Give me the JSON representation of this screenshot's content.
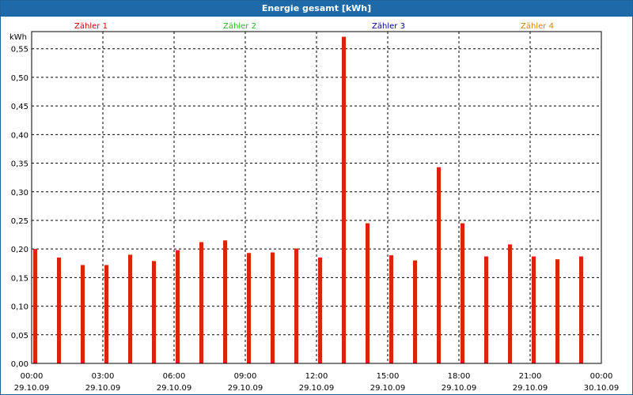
{
  "window": {
    "title": "Energie gesamt [kWh]"
  },
  "chart_data": {
    "type": "bar",
    "title": "Energie gesamt [kWh]",
    "ylabel": "kWh",
    "ylim": [
      0,
      0.58
    ],
    "yticks": [
      "0,00",
      "0,05",
      "0,10",
      "0,15",
      "0,20",
      "0,25",
      "0,30",
      "0,35",
      "0,40",
      "0,45",
      "0,50",
      "0,55"
    ],
    "xticks": [
      {
        "time": "00:00",
        "date": "29.10.09"
      },
      {
        "time": "03:00",
        "date": "29.10.09"
      },
      {
        "time": "06:00",
        "date": "29.10.09"
      },
      {
        "time": "09:00",
        "date": "29.10.09"
      },
      {
        "time": "12:00",
        "date": "29.10.09"
      },
      {
        "time": "15:00",
        "date": "29.10.09"
      },
      {
        "time": "18:00",
        "date": "29.10.09"
      },
      {
        "time": "21:00",
        "date": "29.10.09"
      },
      {
        "time": "00:00",
        "date": "30.10.09"
      }
    ],
    "x": [
      "00:00",
      "01:00",
      "02:00",
      "03:00",
      "04:00",
      "05:00",
      "06:00",
      "07:00",
      "08:00",
      "09:00",
      "10:00",
      "11:00",
      "12:00",
      "13:00",
      "14:00",
      "15:00",
      "16:00",
      "17:00",
      "18:00",
      "19:00",
      "20:00",
      "21:00",
      "22:00",
      "23:00"
    ],
    "legend": [
      {
        "name": "Zähler 1",
        "color": "#cc0000"
      },
      {
        "name": "Zähler 2",
        "color": "#22bb22"
      },
      {
        "name": "Zähler 3",
        "color": "#000099"
      },
      {
        "name": "Zähler 4",
        "color": "#cc8800"
      }
    ],
    "series": [
      {
        "name": "Zähler 1",
        "color": "#dd2211",
        "values": [
          0.2,
          0.185,
          0.172,
          0.172,
          0.19,
          0.179,
          0.198,
          0.212,
          0.215,
          0.193,
          0.194,
          0.201,
          0.185,
          0.571,
          0.245,
          0.189,
          0.18,
          0.343,
          0.245,
          0.187,
          0.208,
          0.187,
          0.182,
          0.187
        ]
      }
    ],
    "grid": true
  }
}
